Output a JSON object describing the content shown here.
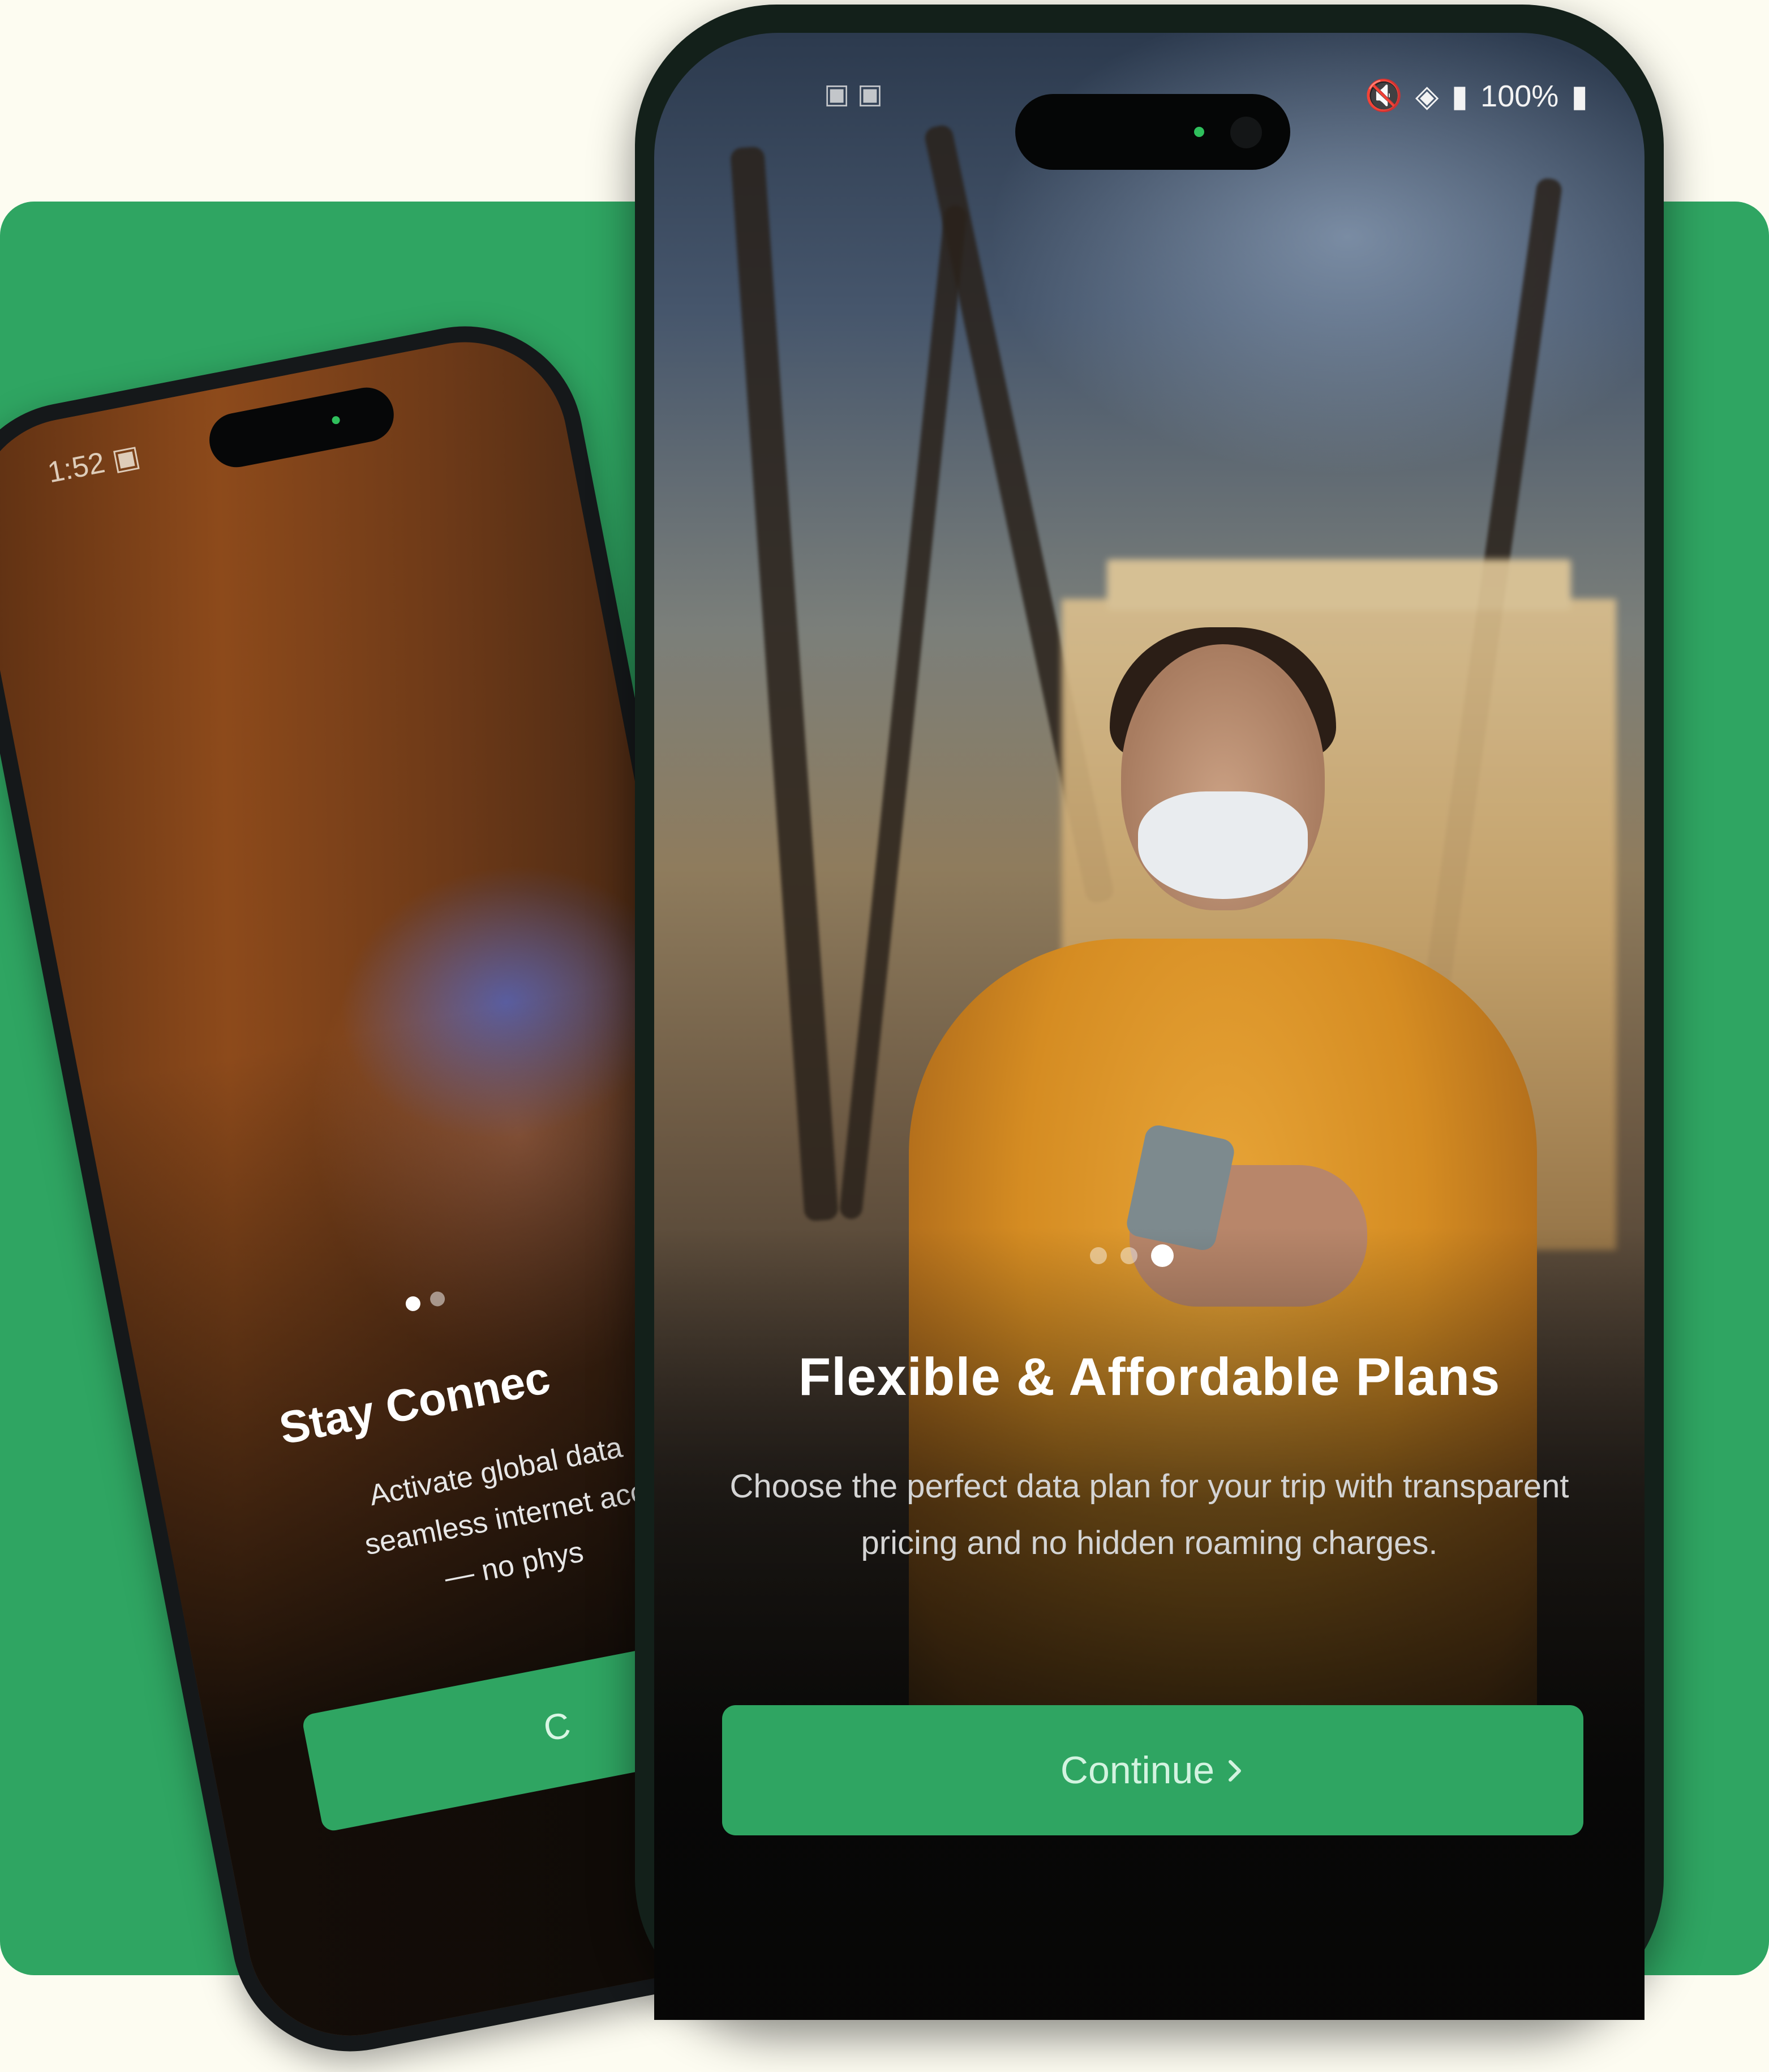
{
  "colors": {
    "page_background": "#fdfcf1",
    "brand_green": "#2fa562",
    "phone_frame": "#15181a"
  },
  "back_phone": {
    "status_time": "1:52",
    "title": "Stay Connec",
    "description_lines": [
      "Activate global data",
      "seamless internet acc",
      "— no phys"
    ],
    "button_label": "C",
    "pagination": {
      "total_visible": 2,
      "active_index": 0
    }
  },
  "front_phone": {
    "status_battery": "100%",
    "title": "Flexible & Affordable Plans",
    "description": "Choose the perfect data plan for your trip with transparent pricing and no hidden roaming charges.",
    "button_label": "Continue",
    "button_icon": "chevron-right-icon",
    "pagination": {
      "total_visible": 3,
      "active_index": 2
    }
  }
}
